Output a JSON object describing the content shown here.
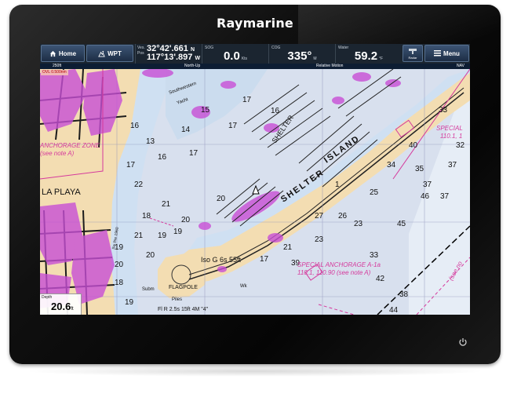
{
  "brand": "Raymarine",
  "databar": {
    "home_label": "Home",
    "wpt_label": "WPT",
    "position": {
      "label1": "Ves.",
      "label2": "Pos",
      "lat": "32°42'.661",
      "lat_hem": "N",
      "lon": "117°13'.897",
      "lon_hem": "W"
    },
    "sog": {
      "label": "SOG",
      "value": "0.0",
      "unit": "Kts"
    },
    "cog": {
      "label": "COG",
      "value": "335°",
      "unit": "M"
    },
    "water": {
      "label": "Water",
      "value": "59.2",
      "unit": "°F"
    },
    "radar_label": "Radar",
    "menu_label": "Menu"
  },
  "status": {
    "range": "250ft",
    "orientation": "North-Up",
    "motion": "Relative Motion",
    "mode": "NAV",
    "ovl": "OVL 0.500nm"
  },
  "depth": {
    "label": "Depth",
    "value": "20.6",
    "unit": "ft"
  },
  "chart": {
    "labels": {
      "shelter": "SHELTER",
      "island": "ISLAND",
      "anchorage_zone": "ANCHORAGE ZONE",
      "see_note": "(see note A)",
      "la_playa": "LA PLAYA",
      "special": "SPECIAL",
      "special_ref": "110.1, 1",
      "special_anchorage": "SPECIAL ANCHORAGE A-1a",
      "special_anchorage_ref": "110.1, 110.90 (see note A)",
      "light": "Iso G 6s 55ft",
      "flagpole": "FLAGPOLE",
      "flash": "Fl R 2.5s 15ft 4M \"4\"",
      "piles": "Piles",
      "subm": "Subm",
      "wk": "Wk",
      "southwestern": "Southwestern",
      "yacht": "Yacht",
      "sw_line": "Sw line 1960",
      "see_note_right": "(see no"
    },
    "soundings": [
      "17",
      "15",
      "16",
      "17",
      "14",
      "13",
      "16",
      "17",
      "16",
      "17",
      "22",
      "20",
      "20",
      "21",
      "18",
      "21",
      "19",
      "20",
      "18",
      "20",
      "19",
      "19",
      "19",
      "17",
      "21",
      "23",
      "26",
      "27",
      "25",
      "23",
      "1",
      "34",
      "35",
      "37",
      "37",
      "32",
      "33",
      "45",
      "46",
      "42",
      "37",
      "44",
      "39",
      "38",
      "33",
      "40"
    ]
  }
}
